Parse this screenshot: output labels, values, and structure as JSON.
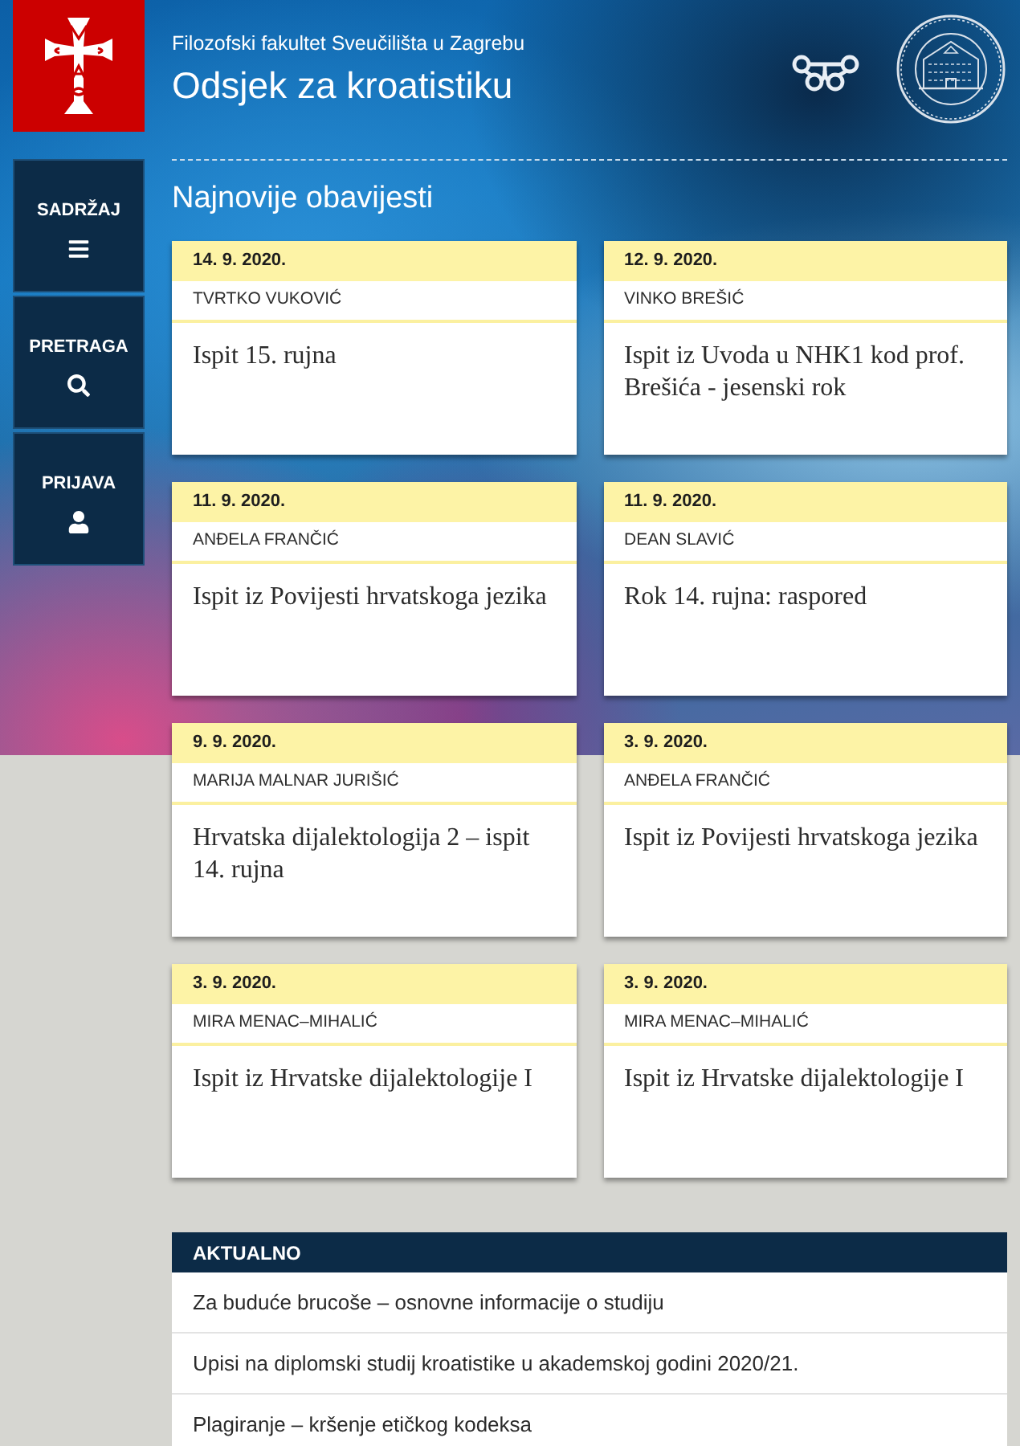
{
  "header": {
    "faculty": "Filozofski fakultet Sveučilišta u Zagrebu",
    "department": "Odsjek za kroatistiku"
  },
  "sidebar": {
    "items": [
      {
        "label": "SADRŽAJ",
        "kind": "menu"
      },
      {
        "label": "PRETRAGA",
        "kind": "search"
      },
      {
        "label": "PRIJAVA",
        "kind": "login"
      }
    ]
  },
  "news": {
    "title": "Najnovije obavijesti",
    "cards": [
      {
        "date": "14. 9. 2020.",
        "author": "TVRTKO VUKOVIĆ",
        "title": "Ispit 15. rujna"
      },
      {
        "date": "12. 9. 2020.",
        "author": "VINKO BREŠIĆ",
        "title": "Ispit iz Uvoda u NHK1 kod prof. Brešića - jesenski rok"
      },
      {
        "date": "11. 9. 2020.",
        "author": "ANĐELA FRANČIĆ",
        "title": "Ispit iz Povijesti hrvatskoga jezika"
      },
      {
        "date": "11. 9. 2020.",
        "author": "DEAN SLAVIĆ",
        "title": "Rok 14. rujna: raspored"
      },
      {
        "date": "9. 9. 2020.",
        "author": "MARIJA MALNAR JURIŠIĆ",
        "title": "Hrvatska dijalektologija 2 – ispit 14. rujna"
      },
      {
        "date": "3. 9. 2020.",
        "author": "ANĐELA FRANČIĆ",
        "title": "Ispit iz Povijesti hrvatskoga jezika"
      },
      {
        "date": "3. 9. 2020.",
        "author": "MIRA MENAC–MIHALIĆ",
        "title": "Ispit iz Hrvatske dijalektologije I"
      },
      {
        "date": "3. 9. 2020.",
        "author": "MIRA MENAC–MIHALIĆ",
        "title": "Ispit iz Hrvatske dijalektologije I"
      }
    ]
  },
  "aktualno": {
    "title": "AKTUALNO",
    "items": [
      "Za buduće brucoše – osnovne informacije o studiju",
      "Upisi na diplomski studij kroatistike u akademskoj godini 2020/21.",
      "Plagiranje – kršenje etičkog kodeksa"
    ]
  }
}
